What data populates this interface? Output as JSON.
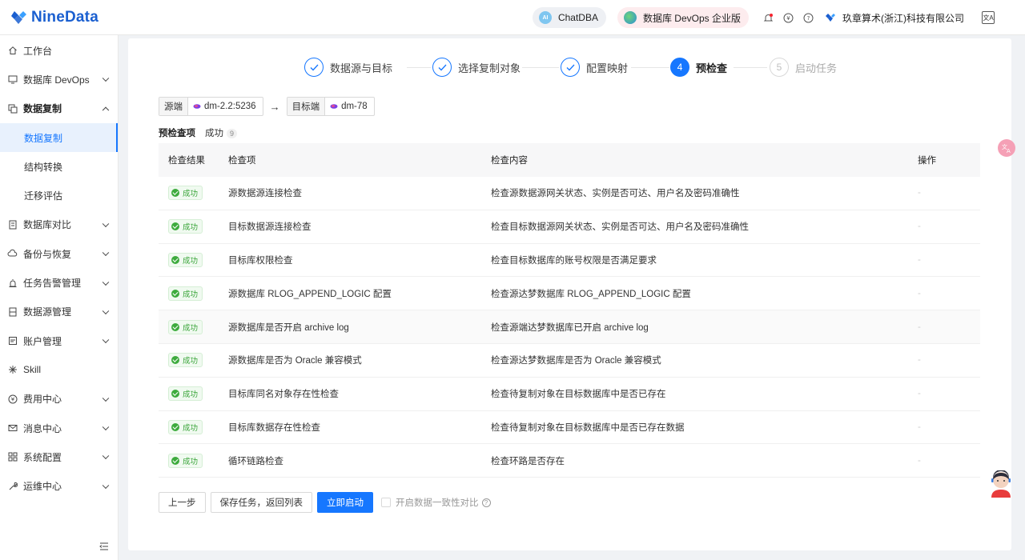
{
  "header": {
    "brand": "NineData",
    "chatdba": "ChatDBA",
    "devops": "数据库 DevOps 企业版",
    "org": "玖章算术(浙江)科技有限公司",
    "lang_icon_text": "文A"
  },
  "sidebar": {
    "items": [
      {
        "label": "工作台",
        "icon": "home-icon"
      },
      {
        "label": "数据库 DevOps",
        "icon": "monitor-icon"
      },
      {
        "label": "数据复制",
        "icon": "copy-icon"
      },
      {
        "label": "数据复制"
      },
      {
        "label": "结构转换"
      },
      {
        "label": "迁移评估"
      },
      {
        "label": "数据库对比",
        "icon": "compare-icon"
      },
      {
        "label": "备份与恢复",
        "icon": "cloud-icon"
      },
      {
        "label": "任务告警管理",
        "icon": "alarm-icon"
      },
      {
        "label": "数据源管理",
        "icon": "datasource-icon"
      },
      {
        "label": "账户管理",
        "icon": "account-icon"
      },
      {
        "label": "Skill",
        "icon": "skill-icon"
      },
      {
        "label": "费用中心",
        "icon": "yen-icon"
      },
      {
        "label": "消息中心",
        "icon": "mail-icon"
      },
      {
        "label": "系统配置",
        "icon": "grid-icon"
      },
      {
        "label": "运维中心",
        "icon": "wrench-icon"
      }
    ]
  },
  "steps": [
    {
      "num": "1",
      "label": "数据源与目标",
      "status": "done"
    },
    {
      "num": "2",
      "label": "选择复制对象",
      "status": "done"
    },
    {
      "num": "3",
      "label": "配置映射",
      "status": "done"
    },
    {
      "num": "4",
      "label": "预检查",
      "status": "active"
    },
    {
      "num": "5",
      "label": "启动任务",
      "status": "wait"
    }
  ],
  "endpoints": {
    "source_label": "源端",
    "source_value": "dm-2.2:5236",
    "arrow": "→",
    "target_label": "目标端",
    "target_value": "dm-78"
  },
  "tabs": {
    "title": "预检查项",
    "success_label": "成功",
    "success_count": "9"
  },
  "table": {
    "headers": [
      "检查结果",
      "检查项",
      "检查内容",
      "操作"
    ],
    "status_label": "成功",
    "empty_action": "-",
    "rows": [
      {
        "item": "源数据源连接检查",
        "content": "检查源数据源网关状态、实例是否可达、用户名及密码准确性"
      },
      {
        "item": "目标数据源连接检查",
        "content": "检查目标数据源网关状态、实例是否可达、用户名及密码准确性"
      },
      {
        "item": "目标库权限检查",
        "content": "检查目标数据库的账号权限是否满足要求"
      },
      {
        "item": "源数据库 RLOG_APPEND_LOGIC 配置",
        "content": "检查源达梦数据库 RLOG_APPEND_LOGIC 配置"
      },
      {
        "item": "源数据库是否开启 archive log",
        "content": "检查源端达梦数据库已开启 archive log"
      },
      {
        "item": "源数据库是否为 Oracle 兼容模式",
        "content": "检查源达梦数据库是否为 Oracle 兼容模式"
      },
      {
        "item": "目标库同名对象存在性检查",
        "content": "检查待复制对象在目标数据库中是否已存在"
      },
      {
        "item": "目标库数据存在性检查",
        "content": "检查待复制对象在目标数据库中是否已存在数据"
      },
      {
        "item": "循环链路检查",
        "content": "检查环路是否存在"
      }
    ]
  },
  "actions": {
    "prev": "上一步",
    "save": "保存任务，返回列表",
    "start": "立即启动",
    "consistency": "开启数据一致性对比"
  },
  "colors": {
    "primary": "#1677ff",
    "success": "#3dab3d",
    "brand": "#1a5fd0"
  }
}
